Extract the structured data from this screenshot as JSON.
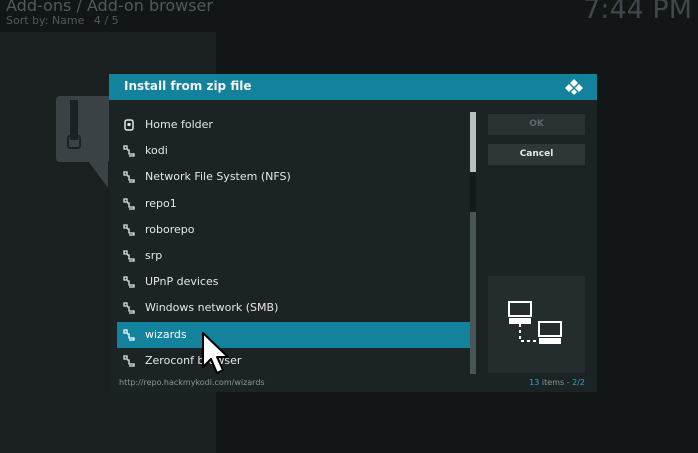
{
  "background": {
    "title": "Add-ons / Add-on browser",
    "sort_label": "Sort by: Name",
    "position": "4 / 5",
    "clock": "7:44 PM"
  },
  "dialog": {
    "title": "Install from zip file",
    "items": [
      {
        "label": "Home folder",
        "icon": "home-folder-icon"
      },
      {
        "label": "kodi",
        "icon": "network-share-icon"
      },
      {
        "label": "Network File System (NFS)",
        "icon": "network-share-icon"
      },
      {
        "label": "repo1",
        "icon": "network-share-icon"
      },
      {
        "label": "roborepo",
        "icon": "network-share-icon"
      },
      {
        "label": "srp",
        "icon": "network-share-icon"
      },
      {
        "label": "UPnP devices",
        "icon": "network-share-icon"
      },
      {
        "label": "Windows network (SMB)",
        "icon": "network-share-icon"
      },
      {
        "label": "wizards",
        "icon": "network-share-icon",
        "selected": true
      },
      {
        "label": "Zeroconf browser",
        "icon": "network-share-icon"
      }
    ],
    "buttons": {
      "ok": "OK",
      "cancel": "Cancel"
    },
    "footer": {
      "path": "http://repo.hackmykodi.com/wizards",
      "count": "13",
      "count_suffix": "items - ",
      "page": "2/2"
    },
    "colors": {
      "accent": "#12829d",
      "panel": "#1c2325"
    }
  }
}
